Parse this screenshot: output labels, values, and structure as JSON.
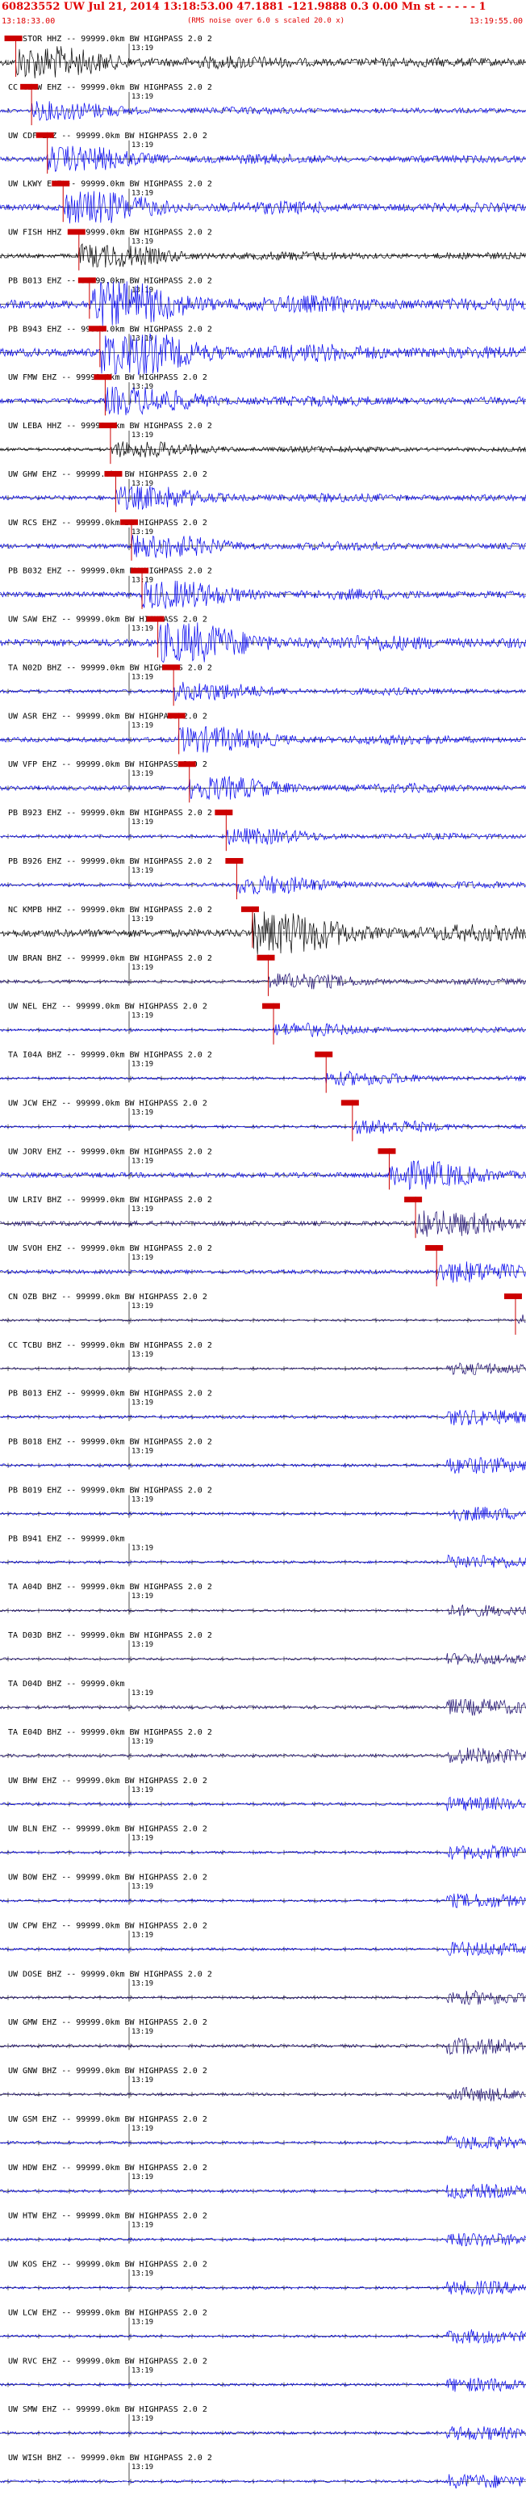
{
  "header": {
    "title": "60823552 UW Jul 21, 2014 13:18:53.00   47.1881 -121.9888  0.3 0.00 Mn st - - - - - 1",
    "start_time": "13:18:33.00",
    "end_time": "13:19:55.00",
    "note": "(RMS noise over 6.0 s scaled 20.0 x)"
  },
  "tick_label": "13:19",
  "colors": {
    "red": "#e00000",
    "blue": "#0000ee",
    "black": "#000000",
    "navy": "#1a0a6e",
    "pick": "#cc0000"
  },
  "traces": [
    {
      "label": "UW STOR HHZ -- 99999.0km BW  HIGHPASS  2.0  2",
      "color": "black",
      "amp": 0.7,
      "pick": 0.03
    },
    {
      "label": "CC CLCW EHZ -- 99999.0km BW  HIGHPASS  2.0  2",
      "color": "blue",
      "amp": 0.4,
      "pick": 0.06
    },
    {
      "label": "UW CDF EHZ -- 99999.0km BW  HIGHPASS  2.0  2",
      "color": "blue",
      "amp": 0.55,
      "pick": 0.09
    },
    {
      "label": "UW LKWY EHZ -- 99999.0km BW  HIGHPASS  2.0  2",
      "color": "blue",
      "amp": 0.7,
      "pick": 0.12
    },
    {
      "label": "UW FISH HHZ -- 99999.0km BW  HIGHPASS  2.0  2",
      "color": "black",
      "amp": 0.5,
      "pick": 0.15
    },
    {
      "label": "PB B013 EHZ -- 99999.0km BW  HIGHPASS  2.0  2",
      "color": "blue",
      "amp": 0.95,
      "pick": 0.17
    },
    {
      "label": "PB B943 EHZ -- 99999.0km BW  HIGHPASS  2.0  2",
      "color": "blue",
      "amp": 0.95,
      "pick": 0.19
    },
    {
      "label": "UW FMW EHZ -- 99999.0km BW  HIGHPASS  2.0  2",
      "color": "blue",
      "amp": 0.6,
      "pick": 0.2
    },
    {
      "label": "UW LEBA HHZ -- 99999.0km BW  HIGHPASS  2.0  2",
      "color": "black",
      "amp": 0.35,
      "pick": 0.21
    },
    {
      "label": "UW GHW EHZ -- 99999.0km BW  HIGHPASS  2.0  2",
      "color": "blue",
      "amp": 0.5,
      "pick": 0.22
    },
    {
      "label": "UW RCS EHZ -- 99999.0km BW  HIGHPASS  2.0  2",
      "color": "blue",
      "amp": 0.5,
      "pick": 0.25
    },
    {
      "label": "PB B032 EHZ -- 99999.0km BW  HIGHPASS  2.0  2",
      "color": "blue",
      "amp": 0.6,
      "pick": 0.27
    },
    {
      "label": "UW SAW EHZ -- 99999.0km BW  HIGHPASS  2.0  2",
      "color": "blue",
      "amp": 0.85,
      "pick": 0.3
    },
    {
      "label": "TA N02D BHZ -- 99999.0km BW  HIGHPASS  2.0  2",
      "color": "blue",
      "amp": 0.4,
      "pick": 0.33
    },
    {
      "label": "UW ASR EHZ -- 99999.0km BW  HIGHPASS  2.0  2",
      "color": "blue",
      "amp": 0.55,
      "pick": 0.34
    },
    {
      "label": "UW VFP EHZ -- 99999.0km BW  HIGHPASS  2.0  2",
      "color": "blue",
      "amp": 0.5,
      "pick": 0.36
    },
    {
      "label": "PB B923 EHZ -- 99999.0km BW  HIGHPASS  2.0  2",
      "color": "blue",
      "amp": 0.35,
      "pick": 0.43
    },
    {
      "label": "PB B926 EHZ -- 99999.0km BW  HIGHPASS  2.0  2",
      "color": "blue",
      "amp": 0.4,
      "pick": 0.45
    },
    {
      "label": "NC KMPB HHZ -- 99999.0km BW  HIGHPASS  2.0  2",
      "color": "black",
      "amp": 0.9,
      "pick": 0.48
    },
    {
      "label": "UW BRAN BHZ -- 99999.0km BW  HIGHPASS  2.0  2",
      "color": "navy",
      "amp": 0.35,
      "pick": 0.51
    },
    {
      "label": "UW NEL EHZ -- 99999.0km BW  HIGHPASS  2.0  2",
      "color": "blue",
      "amp": 0.3,
      "pick": 0.52
    },
    {
      "label": "TA I04A BHZ -- 99999.0km BW  HIGHPASS  2.0  2",
      "color": "blue",
      "amp": 0.3,
      "pick": 0.62
    },
    {
      "label": "UW JCW EHZ -- 99999.0km BW  HIGHPASS  2.0  2",
      "color": "blue",
      "amp": 0.3,
      "pick": 0.67
    },
    {
      "label": "UW JORV EHZ -- 99999.0km BW  HIGHPASS  2.0  2",
      "color": "blue",
      "amp": 0.6,
      "pick": 0.74
    },
    {
      "label": "UW LRIV BHZ -- 99999.0km BW  HIGHPASS  2.0  2",
      "color": "navy",
      "amp": 0.55,
      "pick": 0.79
    },
    {
      "label": "UW SVOH EHZ -- 99999.0km BW  HIGHPASS  2.0  2",
      "color": "blue",
      "amp": 0.45,
      "pick": 0.83
    },
    {
      "label": "CN OZB BHZ -- 99999.0km BW  HIGHPASS  2.0  2",
      "color": "navy",
      "amp": 0.25,
      "pick": 0.98
    },
    {
      "label": "CC TCBU BHZ -- 99999.0km BW  HIGHPASS  2.0  2",
      "color": "navy",
      "amp": 0.25,
      "pick": null
    },
    {
      "label": "PB B013 EHZ -- 99999.0km BW  HIGHPASS  2.0  2",
      "color": "blue",
      "amp": 0.35,
      "pick": null
    },
    {
      "label": "PB B018 EHZ -- 99999.0km BW  HIGHPASS  2.0  2",
      "color": "blue",
      "amp": 0.35,
      "pick": null
    },
    {
      "label": "PB B019 EHZ -- 99999.0km BW  HIGHPASS  2.0  2",
      "color": "blue",
      "amp": 0.3,
      "pick": null
    },
    {
      "label": "PB B941 EHZ -- 99999.0km",
      "color": "blue",
      "amp": 0.3,
      "pick": null
    },
    {
      "label": "TA A04D BHZ -- 99999.0km BW  HIGHPASS  2.0  2",
      "color": "navy",
      "amp": 0.25,
      "pick": null
    },
    {
      "label": "TA D03D BHZ -- 99999.0km BW  HIGHPASS  2.0  2",
      "color": "navy",
      "amp": 0.25,
      "pick": null
    },
    {
      "label": "TA D04D BHZ -- 99999.0km",
      "color": "navy",
      "amp": 0.35,
      "pick": null
    },
    {
      "label": "TA E04D BHZ -- 99999.0km BW  HIGHPASS  2.0  2",
      "color": "navy",
      "amp": 0.35,
      "pick": null
    },
    {
      "label": "UW BHW EHZ -- 99999.0km BW  HIGHPASS  2.0  2",
      "color": "blue",
      "amp": 0.3,
      "pick": null
    },
    {
      "label": "UW BLN EHZ -- 99999.0km BW  HIGHPASS  2.0  2",
      "color": "blue",
      "amp": 0.3,
      "pick": null
    },
    {
      "label": "UW BOW EHZ -- 99999.0km BW  HIGHPASS  2.0  2",
      "color": "blue",
      "amp": 0.3,
      "pick": null
    },
    {
      "label": "UW CPW EHZ -- 99999.0km BW  HIGHPASS  2.0  2",
      "color": "blue",
      "amp": 0.3,
      "pick": null
    },
    {
      "label": "UW DOSE BHZ -- 99999.0km BW  HIGHPASS  2.0  2",
      "color": "navy",
      "amp": 0.3,
      "pick": null
    },
    {
      "label": "UW GMW EHZ -- 99999.0km BW  HIGHPASS  2.0  2",
      "color": "navy",
      "amp": 0.35,
      "pick": null
    },
    {
      "label": "UW GNW BHZ -- 99999.0km BW  HIGHPASS  2.0  2",
      "color": "navy",
      "amp": 0.3,
      "pick": null
    },
    {
      "label": "UW GSM EHZ -- 99999.0km BW  HIGHPASS  2.0  2",
      "color": "blue",
      "amp": 0.3,
      "pick": null
    },
    {
      "label": "UW HDW EHZ -- 99999.0km BW  HIGHPASS  2.0  2",
      "color": "blue",
      "amp": 0.3,
      "pick": null
    },
    {
      "label": "UW HTW EHZ -- 99999.0km BW  HIGHPASS  2.0  2",
      "color": "blue",
      "amp": 0.3,
      "pick": null
    },
    {
      "label": "UW KOS EHZ -- 99999.0km BW  HIGHPASS  2.0  2",
      "color": "blue",
      "amp": 0.3,
      "pick": null
    },
    {
      "label": "UW LCW EHZ -- 99999.0km BW  HIGHPASS  2.0  2",
      "color": "blue",
      "amp": 0.3,
      "pick": null
    },
    {
      "label": "UW RVC EHZ -- 99999.0km BW  HIGHPASS  2.0  2",
      "color": "blue",
      "amp": 0.3,
      "pick": null
    },
    {
      "label": "UW SMW EHZ -- 99999.0km BW  HIGHPASS  2.0  2",
      "color": "blue",
      "amp": 0.3,
      "pick": null
    },
    {
      "label": "UW WISH BHZ -- 99999.0km BW  HIGHPASS  2.0  2",
      "color": "blue",
      "amp": 0.3,
      "pick": null
    }
  ]
}
